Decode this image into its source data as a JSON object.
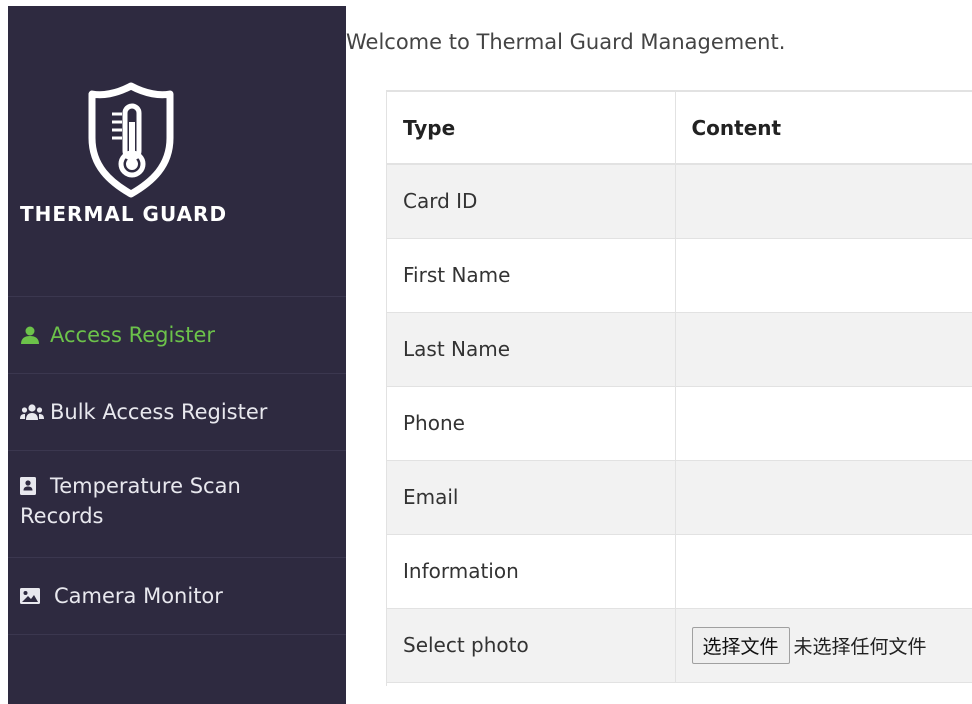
{
  "brand": {
    "name": "THERMAL GUARD"
  },
  "sidebar": {
    "items": [
      {
        "label": "Access Register",
        "icon": "user-icon",
        "active": true
      },
      {
        "label": "Bulk Access Register",
        "icon": "users-icon",
        "active": false
      },
      {
        "label": "Temperature Scan Records",
        "label_line1": "Temperature Scan",
        "label_line2": "Records",
        "icon": "address-card-icon",
        "active": false
      },
      {
        "label": "Camera Monitor",
        "icon": "image-icon",
        "active": false
      }
    ]
  },
  "main": {
    "welcome": "Welcome to Thermal Guard Management.",
    "table": {
      "headers": [
        "Type",
        "Content"
      ],
      "rows": [
        {
          "type": "Card ID",
          "content": ""
        },
        {
          "type": "First Name",
          "content": ""
        },
        {
          "type": "Last Name",
          "content": ""
        },
        {
          "type": "Phone",
          "content": ""
        },
        {
          "type": "Email",
          "content": ""
        },
        {
          "type": "Information",
          "content": ""
        },
        {
          "type": "Select photo",
          "content": ""
        }
      ]
    },
    "file_input": {
      "button_label": "选择文件",
      "status": "未选择任何文件"
    }
  },
  "colors": {
    "sidebar_bg": "#2e2a40",
    "active_item": "#6cc24a",
    "row_alt": "#f2f2f2"
  }
}
